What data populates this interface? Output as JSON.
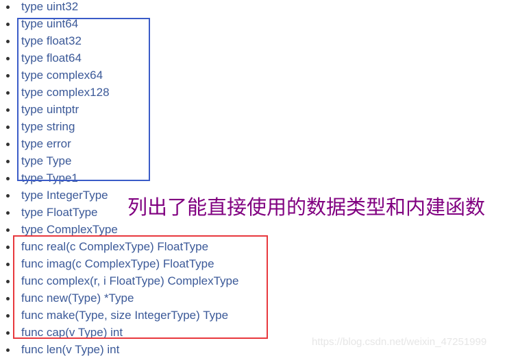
{
  "list": {
    "items": [
      "type uint32",
      "type uint64",
      "type float32",
      "type float64",
      "type complex64",
      "type complex128",
      "type uintptr",
      "type string",
      "type error",
      "type Type",
      "type Type1",
      "type IntegerType",
      "type FloatType",
      "type ComplexType",
      "func real(c ComplexType) FloatType",
      "func imag(c ComplexType) FloatType",
      "func complex(r, i FloatType) ComplexType",
      "func new(Type) *Type",
      "func make(Type, size IntegerType) Type",
      "func cap(v Type) int",
      "func len(v Type) int"
    ]
  },
  "annotation": {
    "text": "列出了能直接使用的数据类型和内建函数",
    "color": "#800080"
  },
  "highlights": {
    "blue_box_color": "#3a5bc7",
    "red_box_color": "#e8383d"
  },
  "watermark": {
    "text": "https://blog.csdn.net/weixin_47251999"
  }
}
